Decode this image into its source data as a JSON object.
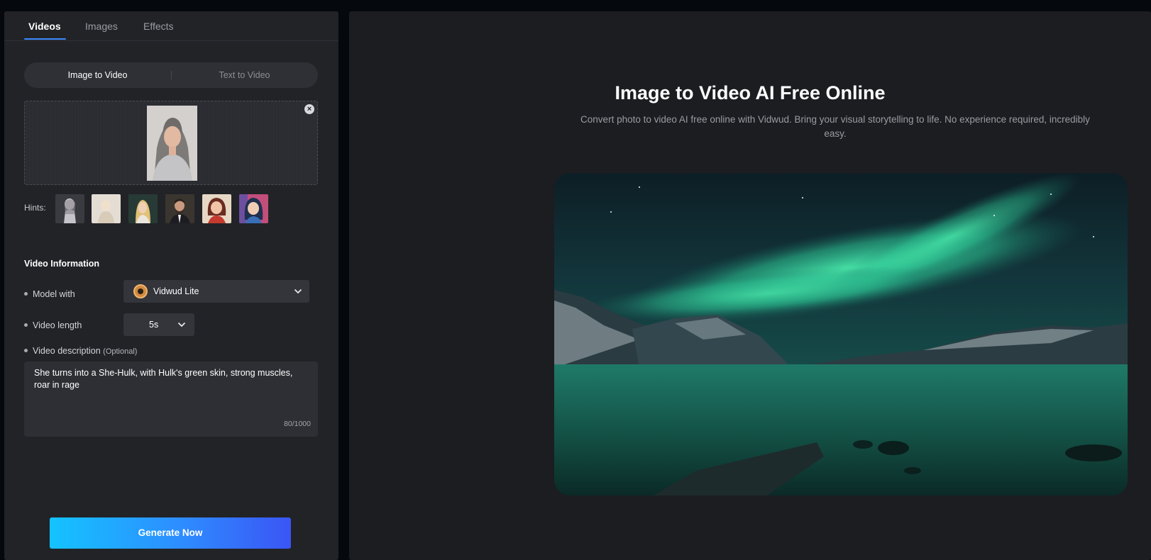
{
  "tabs": [
    "Videos",
    "Images",
    "Effects"
  ],
  "active_tab": "Videos",
  "mode": {
    "image_to_video": "Image to Video",
    "text_to_video": "Text to Video",
    "active": "Image to Video"
  },
  "hints": {
    "label": "Hints:",
    "count": 6
  },
  "video_info": {
    "title": "Video Information",
    "model_label": "Model with",
    "model_value": "Vidwud Lite",
    "length_label": "Video length",
    "length_value": "5s",
    "description_label": "Video description",
    "description_optional": "(Optional)",
    "description_text": "She turns into a She-Hulk, with Hulk's green skin, strong muscles, roar in rage",
    "char_count": "80/1000"
  },
  "generate_label": "Generate Now",
  "hero": {
    "title": "Image to Video AI Free Online",
    "subtitle": "Convert photo to video AI free online with Vidwud. Bring your visual storytelling to life. No experience required, incredibly easy."
  },
  "colors": {
    "accent": "#3d8bff",
    "button_start": "#14c3ff",
    "button_end": "#3a55f5"
  },
  "icons": [
    "close-icon",
    "chevron-down-icon",
    "vidwud-logo-icon"
  ]
}
